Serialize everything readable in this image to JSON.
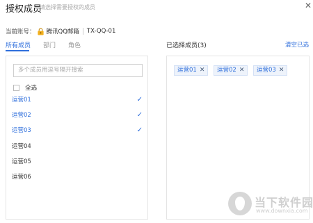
{
  "header": {
    "title": "授权成员",
    "subtitle": "请选择需要授权的成员"
  },
  "account": {
    "label": "当前账号：",
    "icon": "lock-icon",
    "name": "腾讯QQ邮箱",
    "id": "TX-QQ-01"
  },
  "tabs": [
    {
      "label": "所有成员",
      "active": true
    },
    {
      "label": "部门",
      "active": false
    },
    {
      "label": "角色",
      "active": false
    }
  ],
  "search": {
    "placeholder": "多个成员用逗号隔开搜索"
  },
  "select_all": {
    "label": "全选",
    "checked": false
  },
  "members": [
    {
      "name": "运营01",
      "selected": true
    },
    {
      "name": "运营02",
      "selected": true
    },
    {
      "name": "运营03",
      "selected": true
    },
    {
      "name": "运营04",
      "selected": false
    },
    {
      "name": "运营05",
      "selected": false
    },
    {
      "name": "运营06",
      "selected": false
    }
  ],
  "selected_panel": {
    "title": "已选择成员(3)",
    "clear_label": "清空已选",
    "tags": [
      "运营01",
      "运营02",
      "运营03"
    ]
  },
  "watermark": {
    "text": "当下软件园",
    "url": "www.downxia.com"
  },
  "colors": {
    "accent": "#2f6fdc",
    "tag_bg": "#eef3fb",
    "border": "#e4e4e4"
  }
}
